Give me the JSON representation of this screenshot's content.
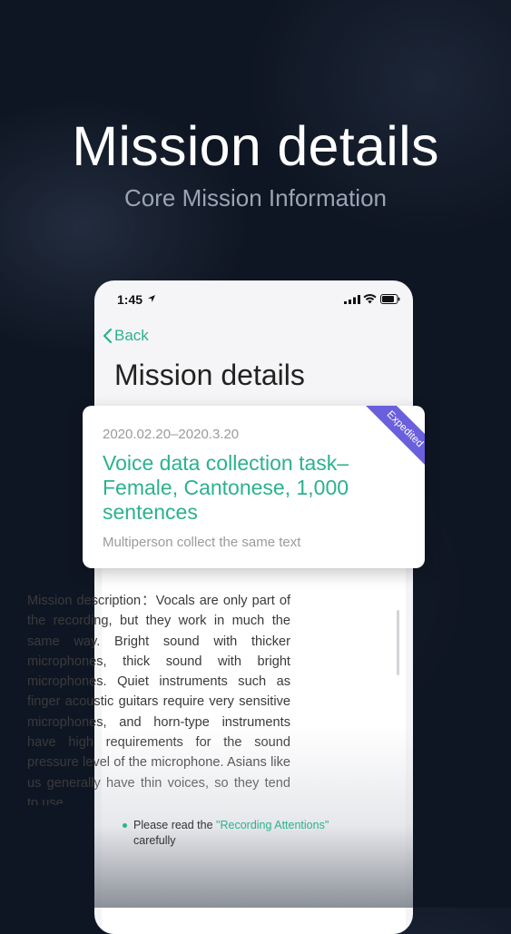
{
  "hero": {
    "title": "Mission details",
    "subtitle": "Core Mission Information"
  },
  "status_bar": {
    "time": "1:45"
  },
  "nav": {
    "back_label": "Back",
    "page_title": "Mission details"
  },
  "card": {
    "date_range": "2020.02.20–2020.3.20",
    "title": "Voice data collection task–Female, Cantonese, 1,000 sentences",
    "subtitle": "Multiperson collect the same text",
    "badge": "Expedited",
    "badge_color": "#6a5fdc"
  },
  "description": {
    "text": "Mission description：Vocals are only part of the recording, but they work in much the same way. Bright sound with thicker microphones, thick sound with bright microphones. Quiet instruments such as finger acoustic guitars require very sensitive microphones, and horn-type instruments have high requirements for the sound pressure level of the microphone. Asians like us generally have thin voices, so they tend to use"
  },
  "notice": {
    "prefix": "Please read the ",
    "link": "\"Recording Attentions\"",
    "suffix": " carefully"
  },
  "colors": {
    "accent": "#2cb18f",
    "background": "#0f1623",
    "badge": "#6a5fdc"
  }
}
